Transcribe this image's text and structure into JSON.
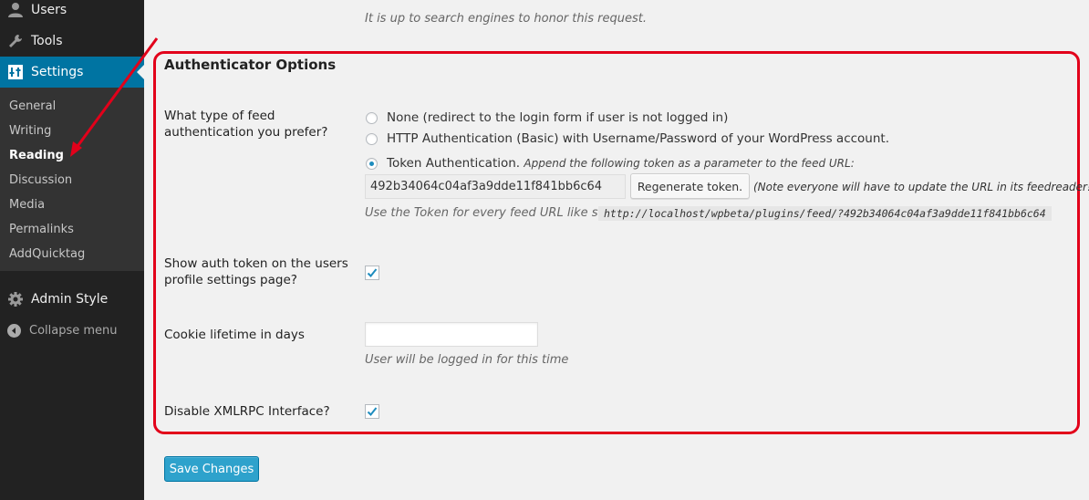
{
  "sidebar": {
    "items": [
      {
        "label": "Users",
        "icon": "users-icon"
      },
      {
        "label": "Tools",
        "icon": "wrench-icon"
      },
      {
        "label": "Settings",
        "icon": "settings-icon"
      }
    ],
    "submenu": [
      "General",
      "Writing",
      "Reading",
      "Discussion",
      "Media",
      "Permalinks",
      "AddQuicktag"
    ],
    "current_submenu": "Reading",
    "admin_style": {
      "label": "Admin Style",
      "icon": "gear-icon"
    },
    "collapse": {
      "label": "Collapse menu",
      "icon": "collapse-icon"
    },
    "accent_color": "#0074a2"
  },
  "main": {
    "top_description": "It is up to search engines to honor this request.",
    "section_title": "Authenticator Options",
    "feed_auth": {
      "label": "What type of feed authentication you prefer?",
      "options": [
        {
          "label": "None (redirect to the login form if user is not logged in)",
          "checked": false
        },
        {
          "label": "HTTP Authentication (Basic) with Username/Password of your WordPress account.",
          "checked": false
        },
        {
          "label": "Token Authentication.",
          "note": "Append the following token as a parameter to the feed URL:",
          "checked": true
        }
      ],
      "token_value": "492b34064c04af3a9dde11f841bb6c64",
      "regenerate_label": "Regenerate token.",
      "regenerate_note": "(Note everyone will have to update the URL in its feedreader!)",
      "hint": "Use the Token for every feed URL like so:",
      "example_url": "http://localhost/wpbeta/plugins/feed/?492b34064c04af3a9dde11f841bb6c64"
    },
    "show_token": {
      "label": "Show auth token on the users profile settings page?",
      "checked": true
    },
    "cookie_lifetime": {
      "label": "Cookie lifetime in days",
      "value": "",
      "description": "User will be logged in for this time"
    },
    "disable_xmlrpc": {
      "label": "Disable XMLRPC Interface?",
      "checked": true
    },
    "save_label": "Save Changes",
    "highlight_color": "#e2001a"
  }
}
